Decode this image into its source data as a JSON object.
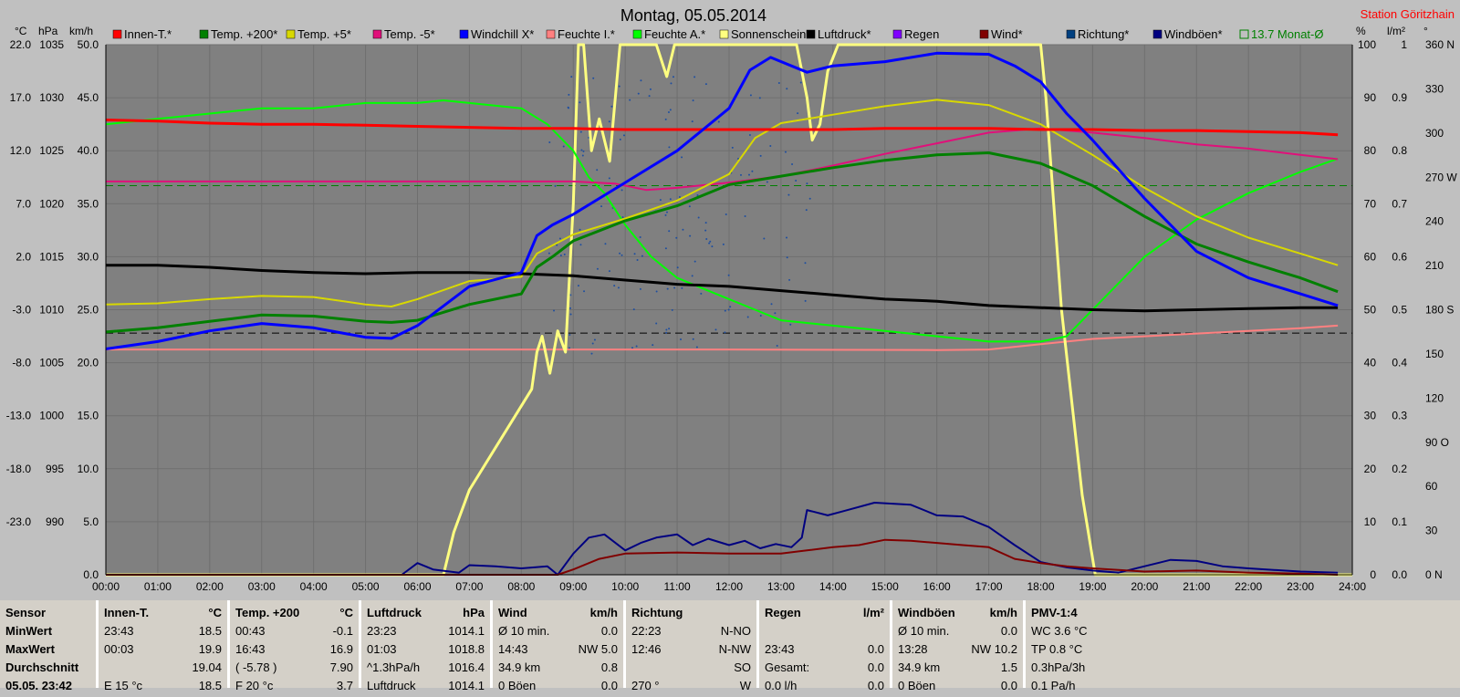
{
  "chart_data": {
    "type": "line",
    "title": "Montag, 05.05.2014",
    "station": "Station Göritzhain",
    "axes": {
      "left_units": [
        "°C",
        "hPa",
        "km/h"
      ],
      "right_units": [
        "%",
        "l/m²",
        "°"
      ],
      "temp": {
        "label": "°C",
        "ticks": [
          "22.0",
          "17.0",
          "12.0",
          "7.0",
          "2.0",
          "-3.0",
          "-8.0",
          "-13.0",
          "-18.0",
          "-23.0"
        ]
      },
      "pressure": {
        "label": "hPa",
        "ticks": [
          "1035",
          "1030",
          "1025",
          "1020",
          "1015",
          "1010",
          "1005",
          "1000",
          "995",
          "990"
        ]
      },
      "wind": {
        "label": "km/h",
        "ticks": [
          "50.0",
          "45.0",
          "40.0",
          "35.0",
          "30.0",
          "25.0",
          "20.0",
          "15.0",
          "10.0",
          "5.0",
          "0.0"
        ]
      },
      "humidity": {
        "label": "%",
        "ticks": [
          "100",
          "90",
          "80",
          "70",
          "60",
          "50",
          "40",
          "30",
          "20",
          "10",
          "0"
        ]
      },
      "rain": {
        "label": "l/m²",
        "ticks": [
          "1",
          "0.9",
          "0.8",
          "0.7",
          "0.6",
          "0.5",
          "0.4",
          "0.3",
          "0.2",
          "0.1",
          "0.0"
        ]
      },
      "direction": {
        "label": "°",
        "ticks": [
          "360 N",
          "330",
          "300",
          "270 W",
          "240",
          "210",
          "180 S",
          "150",
          "120",
          "90 O",
          "60",
          "30",
          "0 N"
        ]
      },
      "x_ticks": [
        "00:00",
        "01:00",
        "02:00",
        "03:00",
        "04:00",
        "05:00",
        "06:00",
        "07:00",
        "08:00",
        "09:00",
        "10:00",
        "11:00",
        "12:00",
        "13:00",
        "14:00",
        "15:00",
        "16:00",
        "17:00",
        "18:00",
        "19:00",
        "20:00",
        "21:00",
        "22:00",
        "23:00",
        "24:00"
      ]
    },
    "legend": [
      {
        "name": "Innen-T.*",
        "color": "#ff0000"
      },
      {
        "name": "Temp. +200*",
        "color": "#008000"
      },
      {
        "name": "Temp. +5*",
        "color": "#d8d800"
      },
      {
        "name": "Temp. -5*",
        "color": "#e0107a"
      },
      {
        "name": "Windchill X*",
        "color": "#0000ff"
      },
      {
        "name": "Feuchte I.*",
        "color": "#ff8080"
      },
      {
        "name": "Feuchte A.*",
        "color": "#00ff00"
      },
      {
        "name": "Sonnenschein",
        "color": "#ffff80"
      },
      {
        "name": "Luftdruck*",
        "color": "#000000"
      },
      {
        "name": "Regen",
        "color": "#8000ff"
      },
      {
        "name": "Wind*",
        "color": "#800000"
      },
      {
        "name": "Richtung*",
        "color": "#004080"
      },
      {
        "name": "Windböen*",
        "color": "#000080"
      },
      {
        "name": "13.7 Monat-Ø",
        "color": "#008000"
      }
    ],
    "reference_lines": [
      {
        "name": "13.7 Monat-Ø",
        "axis": "temp",
        "value": 13.7,
        "color": "#008000"
      },
      {
        "axis": "temp",
        "value": -0.2,
        "color": "#000000"
      }
    ],
    "series": [
      {
        "name": "Innen-T.*",
        "axis": "temp",
        "color": "#ff0000",
        "width": 3,
        "x": [
          0,
          1,
          2,
          3,
          4,
          5,
          6,
          7,
          8,
          9,
          10,
          11,
          12,
          13,
          14,
          15,
          16,
          17,
          18,
          19,
          20,
          21,
          22,
          23,
          23.72
        ],
        "y": [
          19.9,
          19.8,
          19.6,
          19.5,
          19.5,
          19.4,
          19.3,
          19.2,
          19.1,
          19.1,
          19.0,
          19.0,
          19.0,
          19.0,
          19.0,
          19.1,
          19.1,
          19.1,
          19.0,
          19.0,
          18.9,
          18.9,
          18.8,
          18.7,
          18.5
        ]
      },
      {
        "name": "Temp. +200*",
        "axis": "temp",
        "color": "#008000",
        "width": 3,
        "x": [
          0,
          1,
          2,
          3,
          4,
          5,
          5.5,
          6,
          7,
          8,
          8.3,
          8.6,
          9,
          10,
          11,
          12,
          13,
          14,
          15,
          16,
          17,
          18,
          19,
          20,
          21,
          22,
          23,
          23.72
        ],
        "y": [
          -0.1,
          0.3,
          0.9,
          1.5,
          1.4,
          0.9,
          0.8,
          1.0,
          2.5,
          3.5,
          6,
          7,
          8.5,
          10.4,
          11.8,
          13.8,
          14.6,
          15.4,
          16.1,
          16.6,
          16.8,
          15.8,
          13.7,
          10.8,
          8.2,
          6.5,
          5.0,
          3.7
        ]
      },
      {
        "name": "Temp. +5*",
        "axis": "temp",
        "color": "#d8d800",
        "width": 2,
        "x": [
          0,
          1,
          2,
          3,
          4,
          5,
          5.5,
          6,
          7,
          8,
          8.3,
          9,
          10,
          11,
          12,
          12.5,
          13,
          14,
          15,
          16,
          17,
          18,
          19,
          20,
          21,
          22,
          23,
          23.72
        ],
        "y": [
          2.5,
          2.6,
          3.0,
          3.3,
          3.2,
          2.5,
          2.3,
          3.0,
          4.7,
          5.1,
          7.3,
          9.1,
          10.6,
          12.3,
          14.8,
          18.2,
          19.6,
          20.4,
          21.2,
          21.8,
          21.3,
          19.5,
          16.6,
          13.5,
          10.8,
          8.8,
          7.3,
          6.2
        ]
      },
      {
        "name": "Temp. -5*",
        "axis": "temp",
        "color": "#e0107a",
        "width": 2,
        "x": [
          0,
          2,
          4,
          6,
          8,
          9,
          9.8,
          10.4,
          11,
          12,
          13,
          14,
          15,
          16,
          17,
          18,
          19,
          20,
          21,
          22,
          23,
          23.72
        ],
        "y": [
          14.1,
          14.1,
          14.1,
          14.1,
          14.1,
          14.1,
          13.9,
          13.3,
          13.5,
          14,
          14.6,
          15.6,
          16.7,
          17.7,
          18.7,
          19.1,
          18.7,
          18.2,
          17.6,
          17.2,
          16.6,
          16.2
        ]
      },
      {
        "name": "Windchill X*",
        "axis": "temp",
        "color": "#0000ff",
        "width": 3,
        "x": [
          0,
          1,
          2,
          3,
          4,
          5,
          5.5,
          6,
          7,
          8,
          8.3,
          8.6,
          9,
          10,
          11,
          12,
          12.4,
          12.8,
          13.5,
          14,
          15,
          16,
          17,
          17.5,
          18,
          18.5,
          19,
          20,
          21,
          22,
          23,
          23.72
        ],
        "y": [
          -1.7,
          -1.0,
          0,
          0.7,
          0.3,
          -0.6,
          -0.7,
          0.5,
          4.2,
          5.5,
          9.0,
          10.0,
          11,
          14,
          17,
          21,
          24.6,
          25.8,
          24.4,
          25.0,
          25.4,
          26.2,
          26.1,
          25,
          23.5,
          20.5,
          18,
          12.5,
          7.5,
          5.0,
          3.5,
          2.4
        ]
      },
      {
        "name": "Feuchte I.*",
        "axis": "humidity",
        "color": "#ff8080",
        "width": 2,
        "x": [
          0,
          4,
          8,
          12,
          16,
          17,
          18,
          19,
          20,
          21,
          22,
          23,
          23.72
        ],
        "y": [
          42.5,
          42.5,
          42.5,
          42.5,
          42.4,
          42.5,
          43.5,
          44.5,
          45,
          45.5,
          46,
          46.5,
          47
        ]
      },
      {
        "name": "Feuchte A.*",
        "axis": "humidity",
        "color": "#00ff00",
        "width": 2,
        "x": [
          0,
          1,
          2,
          3,
          4,
          5,
          6,
          6.5,
          7,
          8,
          8.5,
          9,
          9.3,
          9.6,
          10,
          10.5,
          11,
          11.5,
          12,
          12.5,
          13,
          13.5,
          14,
          15,
          16,
          17,
          18,
          18.5,
          19,
          20,
          21,
          22,
          23,
          23.72
        ],
        "y": [
          85,
          86,
          87,
          88,
          88,
          89,
          89,
          89.5,
          89,
          88,
          85,
          80,
          75,
          72,
          66,
          60,
          56,
          54,
          52,
          50,
          48,
          47.5,
          47,
          46,
          45,
          44,
          44,
          45,
          50,
          60,
          67,
          72,
          76,
          78.5
        ]
      },
      {
        "name": "Sonnenschein",
        "axis": "humidity",
        "color": "#ffff80",
        "width": 3,
        "x": [
          0,
          6.5,
          6.7,
          7,
          8.2,
          8.3,
          8.4,
          8.55,
          8.7,
          8.85,
          9.0,
          9.1,
          9.2,
          9.35,
          9.5,
          9.7,
          9.9,
          10,
          10.3,
          10.6,
          10.8,
          10.95,
          11.1,
          11.4,
          12,
          12.7,
          13.3,
          13.5,
          13.6,
          13.75,
          13.9,
          14.1,
          14.5,
          15,
          16,
          17,
          18,
          18.1,
          18.4,
          18.8,
          19.05,
          19.2,
          20,
          24
        ],
        "y": [
          0,
          0,
          8,
          16,
          35,
          42,
          45,
          38,
          46,
          42,
          70,
          100,
          100,
          80,
          86,
          78,
          100,
          100,
          100,
          100,
          94,
          100,
          100,
          100,
          100,
          100,
          100,
          90,
          82,
          85,
          95,
          100,
          100,
          100,
          100,
          100,
          100,
          90,
          50,
          15,
          0,
          0,
          0,
          0
        ]
      },
      {
        "name": "Luftdruck*",
        "axis": "pressure",
        "color": "#000000",
        "width": 3,
        "x": [
          0,
          1,
          2,
          3,
          4,
          5,
          6,
          7,
          8,
          9,
          10,
          11,
          12,
          13,
          14,
          15,
          16,
          17,
          18,
          19,
          20,
          21,
          22,
          23,
          23.72
        ],
        "y": [
          1019.2,
          1019.2,
          1019.0,
          1018.7,
          1018.5,
          1018.4,
          1018.5,
          1018.5,
          1018.4,
          1018.2,
          1017.8,
          1017.4,
          1017.2,
          1016.8,
          1016.4,
          1016.0,
          1015.8,
          1015.4,
          1015.2,
          1015.0,
          1014.9,
          1015.0,
          1015.1,
          1015.2,
          1015.2
        ]
      },
      {
        "name": "Wind*",
        "axis": "wind",
        "color": "#800000",
        "width": 2,
        "x": [
          0,
          8.7,
          9.0,
          9.5,
          10,
          11,
          12,
          13,
          13.5,
          14,
          14.5,
          15,
          15.5,
          16,
          16.5,
          17,
          17.5,
          18,
          18.5,
          19,
          20,
          21,
          22,
          23,
          23.72
        ],
        "y": [
          0,
          0,
          0.5,
          1.5,
          2.0,
          2.1,
          2.0,
          2.0,
          2.3,
          2.6,
          2.8,
          3.3,
          3.2,
          3.0,
          2.8,
          2.6,
          1.5,
          1.1,
          0.8,
          0.6,
          0.3,
          0.4,
          0.2,
          0.1,
          0
        ]
      },
      {
        "name": "Windböen*",
        "axis": "wind",
        "color": "#000080",
        "width": 2,
        "x": [
          0,
          5.7,
          6.0,
          6.3,
          6.8,
          7.0,
          7.5,
          8.0,
          8.5,
          8.7,
          9.0,
          9.3,
          9.6,
          10,
          10.3,
          10.6,
          11,
          11.3,
          11.6,
          12,
          12.3,
          12.6,
          12.9,
          13.2,
          13.4,
          13.5,
          13.9,
          14.2,
          14.8,
          15.5,
          16,
          16.5,
          17,
          17.5,
          18,
          18.5,
          19,
          19.5,
          20,
          20.5,
          21,
          21.5,
          22,
          23,
          23.72
        ],
        "y": [
          0,
          0,
          1.1,
          0.5,
          0.2,
          0.9,
          0.8,
          0.6,
          0.8,
          0,
          2.0,
          3.5,
          3.8,
          2.3,
          3.0,
          3.5,
          3.8,
          2.8,
          3.4,
          2.8,
          3.2,
          2.5,
          2.9,
          2.6,
          3.5,
          6.1,
          5.6,
          6.0,
          6.8,
          6.6,
          5.6,
          5.5,
          4.5,
          2.8,
          1.2,
          0.7,
          0.4,
          0.2,
          0.8,
          1.4,
          1.3,
          0.8,
          0.6,
          0.3,
          0.2
        ]
      }
    ]
  },
  "table": {
    "sensor": {
      "header": "Sensor",
      "rows": [
        "MinWert",
        "MaxWert",
        "Durchschnitt",
        "05.05. 23:42"
      ]
    },
    "innen": {
      "title": "Innen-T.",
      "unit": "°C",
      "rows": [
        [
          "23:43",
          "18.5"
        ],
        [
          "00:03",
          "19.9"
        ],
        [
          "",
          "19.04"
        ],
        [
          "E 15 °c",
          "18.5"
        ]
      ]
    },
    "temp200": {
      "title": "Temp. +200",
      "unit": "°C",
      "rows": [
        [
          "00:43",
          "-0.1"
        ],
        [
          "16:43",
          "16.9"
        ],
        [
          "( -5.78 )",
          "7.90"
        ],
        [
          "F 20 °c",
          "3.7"
        ]
      ]
    },
    "luftdruck": {
      "title": "Luftdruck",
      "unit": "hPa",
      "rows": [
        [
          "23:23",
          "1014.1"
        ],
        [
          "01:03",
          "1018.8"
        ],
        [
          "^1.3hPa/h",
          "1016.4"
        ],
        [
          "Luftdruck",
          "1014.1"
        ]
      ]
    },
    "wind": {
      "title": "Wind",
      "unit": "km/h",
      "rows": [
        [
          "Ø 10 min.",
          "0.0"
        ],
        [
          "14:43",
          "NW 5.0"
        ],
        [
          "34.9 km",
          "0.8"
        ],
        [
          "0 Böen",
          "0.0"
        ]
      ]
    },
    "richtung": {
      "title": "Richtung",
      "unit": "",
      "rows": [
        [
          "22:23",
          "N-NO"
        ],
        [
          "12:46",
          "N-NW"
        ],
        [
          "",
          "SO"
        ],
        [
          "270 °",
          "W"
        ]
      ]
    },
    "regen": {
      "title": "Regen",
      "unit": "l/m²",
      "rows": [
        [
          "",
          "",
          ""
        ],
        [
          "23:43",
          "0.0"
        ],
        [
          "Gesamt:",
          "0.0"
        ],
        [
          "0.0 l/h",
          "0.0"
        ]
      ]
    },
    "boeen": {
      "title": "Windböen",
      "unit": "km/h",
      "rows": [
        [
          "Ø 10 min.",
          "0.0"
        ],
        [
          "13:28",
          "NW 10.2"
        ],
        [
          "34.9 km",
          "1.5"
        ],
        [
          "0 Böen",
          "0.0"
        ]
      ]
    },
    "pmv": {
      "title": "PMV-1:4",
      "rows": [
        "WC 3.6 °C",
        "TP 0.8 °C",
        "0.3hPa/3h",
        "0.1 Pa/h"
      ]
    }
  }
}
